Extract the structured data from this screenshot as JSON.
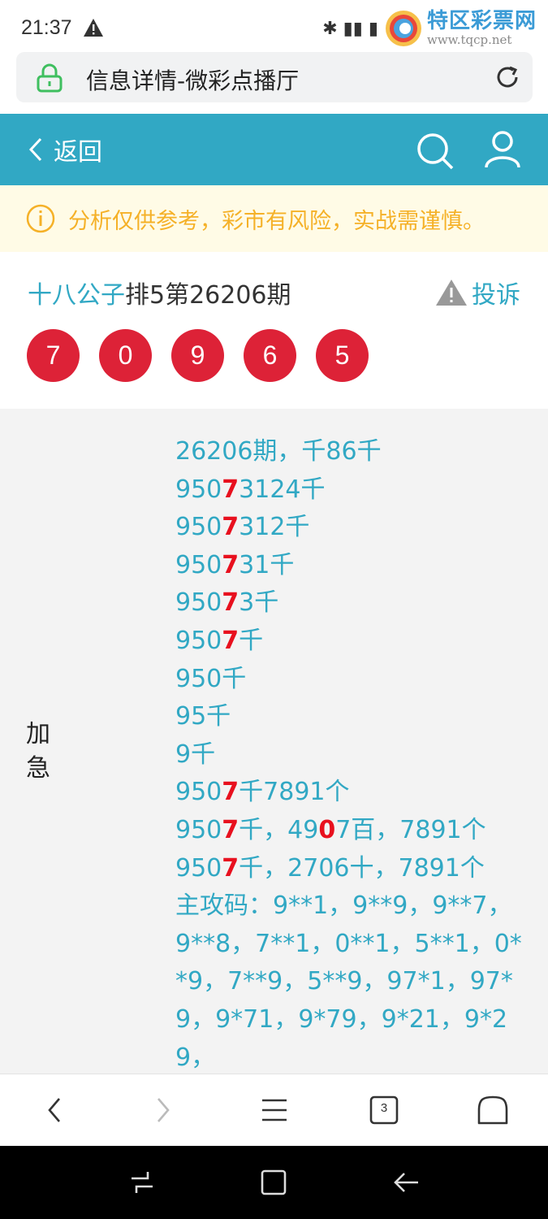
{
  "status_bar": {
    "time": "21:37",
    "icons_text": "✱ ▮▮ ▮",
    "watermark_title": "特区彩票网",
    "watermark_url": "www.tqcp.net"
  },
  "browser": {
    "page_title": "信息详情-微彩点播厅"
  },
  "header": {
    "back_label": "返回"
  },
  "notice": {
    "text": "分析仅供参考，彩市有风险，实战需谨慎。"
  },
  "post": {
    "author": "十八公子",
    "game_issue": "排5第26206期",
    "report_label": "投诉",
    "balls": [
      "7",
      "0",
      "9",
      "6",
      "5"
    ],
    "label": "加急",
    "lines": [
      "26206期，千86千",
      "9507",
      "3124千",
      "9507",
      "312千",
      "9507",
      "31千",
      "9507",
      "3千",
      "9507",
      "千",
      "950千",
      "95千",
      "9千",
      "9507",
      "千7891个",
      "9507",
      "千，4907百，7891个",
      "9507",
      "千，2706十，7891个",
      "主攻码：9**1，9**9，9**7，",
      "9**8，7**1，0**1，5**1，0*",
      "*9，7**9，5**9，97*1，97*",
      "9，9*71，9*79，9*21，9*2",
      "9，"
    ]
  },
  "colors": {
    "accent": "#31a8c4",
    "ball": "#dd2237",
    "highlight": "#e8101e",
    "notice_text": "#f5b128"
  },
  "bottom_bar": {
    "tab_count": "3"
  }
}
